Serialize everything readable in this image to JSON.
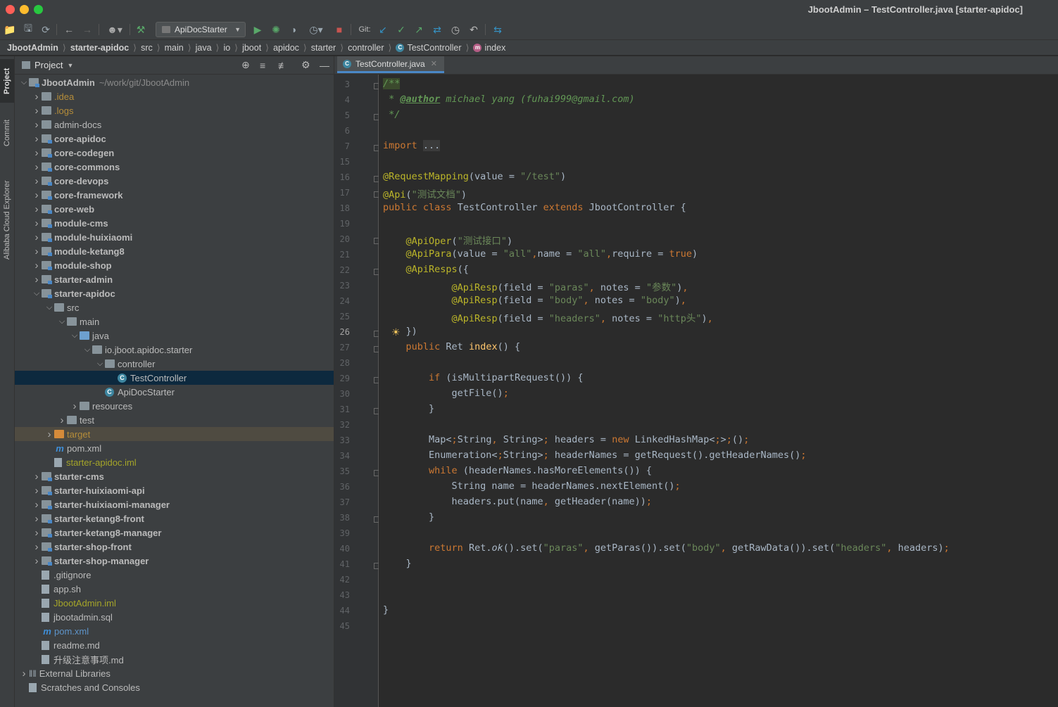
{
  "window": {
    "title": "JbootAdmin – TestController.java [starter-apidoc]"
  },
  "toolbar": {
    "run_config": "ApiDocStarter",
    "git_label": "Git:"
  },
  "breadcrumb": [
    "JbootAdmin",
    "starter-apidoc",
    "src",
    "main",
    "java",
    "io",
    "jboot",
    "apidoc",
    "starter",
    "controller",
    "TestController",
    "index"
  ],
  "side_tabs": [
    "Project",
    "Commit",
    "Alibaba Cloud Explorer"
  ],
  "project_panel": {
    "title": "Project",
    "tree": [
      {
        "label": "JbootAdmin",
        "path": "~/work/git/JbootAdmin"
      },
      {
        "label": ".idea"
      },
      {
        "label": ".logs"
      },
      {
        "label": "admin-docs"
      },
      {
        "label": "core-apidoc"
      },
      {
        "label": "core-codegen"
      },
      {
        "label": "core-commons"
      },
      {
        "label": "core-devops"
      },
      {
        "label": "core-framework"
      },
      {
        "label": "core-web"
      },
      {
        "label": "module-cms"
      },
      {
        "label": "module-huixiaomi"
      },
      {
        "label": "module-ketang8"
      },
      {
        "label": "module-shop"
      },
      {
        "label": "starter-admin"
      },
      {
        "label": "starter-apidoc"
      },
      {
        "label": "src"
      },
      {
        "label": "main"
      },
      {
        "label": "java"
      },
      {
        "label": "io.jboot.apidoc.starter"
      },
      {
        "label": "controller"
      },
      {
        "label": "TestController"
      },
      {
        "label": "ApiDocStarter"
      },
      {
        "label": "resources"
      },
      {
        "label": "test"
      },
      {
        "label": "target"
      },
      {
        "label": "pom.xml"
      },
      {
        "label": "starter-apidoc.iml"
      },
      {
        "label": "starter-cms"
      },
      {
        "label": "starter-huixiaomi-api"
      },
      {
        "label": "starter-huixiaomi-manager"
      },
      {
        "label": "starter-ketang8-front"
      },
      {
        "label": "starter-ketang8-manager"
      },
      {
        "label": "starter-shop-front"
      },
      {
        "label": "starter-shop-manager"
      },
      {
        "label": ".gitignore"
      },
      {
        "label": "app.sh"
      },
      {
        "label": "JbootAdmin.iml"
      },
      {
        "label": "jbootadmin.sql"
      },
      {
        "label": "pom.xml"
      },
      {
        "label": "readme.md"
      },
      {
        "label": "升级注意事项.md"
      },
      {
        "label": "External Libraries"
      },
      {
        "label": "Scratches and Consoles"
      }
    ]
  },
  "editor": {
    "tab": "TestController.java",
    "current_line": "26",
    "line_numbers": [
      "3",
      "4",
      "5",
      "6",
      "7",
      "15",
      "16",
      "17",
      "18",
      "19",
      "20",
      "21",
      "22",
      "23",
      "24",
      "25",
      "26",
      "27",
      "28",
      "29",
      "30",
      "31",
      "32",
      "33",
      "34",
      "35",
      "36",
      "37",
      "38",
      "39",
      "40",
      "41",
      "42",
      "43",
      "44",
      "45"
    ],
    "code": [
      "/**",
      " * @author michael yang (fuhai999@gmail.com)",
      " */",
      "",
      "import ...",
      "",
      "@RequestMapping(value = \"/test\")",
      "@Api(\"测试文档\")",
      "public class TestController extends JbootController {",
      "",
      "    @ApiOper(\"测试接口\")",
      "    @ApiPara(value = \"all\",name = \"all\",require = true)",
      "    @ApiResps({",
      "            @ApiResp(field = \"paras\", notes = \"参数\"),",
      "            @ApiResp(field = \"body\", notes = \"body\"),",
      "            @ApiResp(field = \"headers\", notes = \"http头\"),",
      "    })",
      "    public Ret index() {",
      "",
      "        if (isMultipartRequest()) {",
      "            getFile();",
      "        }",
      "",
      "        Map<String, String> headers = new LinkedHashMap<>();",
      "        Enumeration<String> headerNames = getRequest().getHeaderNames();",
      "        while (headerNames.hasMoreElements()) {",
      "            String name = headerNames.nextElement();",
      "            headers.put(name, getHeader(name));",
      "        }",
      "",
      "        return Ret.ok().set(\"paras\", getParas()).set(\"body\", getRawData()).set(\"headers\", headers);",
      "    }",
      "",
      "",
      "}",
      ""
    ]
  },
  "colors": {
    "editor_bg": "#2b2b2b",
    "panel_bg": "#3c3f41",
    "selection": "#0d293e",
    "accent": "#4a88c7",
    "keyword": "#cc7832",
    "string": "#6a8759",
    "annotation": "#bbb529"
  }
}
